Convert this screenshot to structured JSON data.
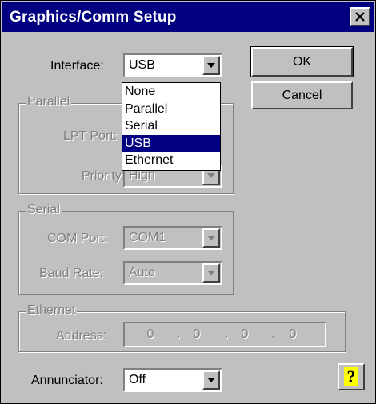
{
  "window": {
    "title": "Graphics/Comm Setup"
  },
  "interface": {
    "label": "Interface:",
    "value": "USB",
    "options": [
      "None",
      "Parallel",
      "Serial",
      "USB",
      "Ethernet"
    ],
    "selected_index": 3
  },
  "buttons": {
    "ok": "OK",
    "cancel": "Cancel"
  },
  "parallel": {
    "legend": "Parallel",
    "lpt_label": "LPT Port:",
    "priority_label": "Priority:",
    "priority_value": "High"
  },
  "serial": {
    "legend": "Serial",
    "com_label": "COM Port:",
    "com_value": "COM1",
    "baud_label": "Baud Rate:",
    "baud_value": "Auto"
  },
  "ethernet": {
    "legend": "Ethernet",
    "address_label": "Address:",
    "octets": [
      "0",
      "0",
      "0",
      "0"
    ],
    "separator": "."
  },
  "annunciator": {
    "label": "Annunciator:",
    "value": "Off"
  },
  "icons": {
    "close": "close-icon",
    "dropdown": "chevron-down-icon",
    "help": "help-icon"
  },
  "colors": {
    "titlebar": "#000080",
    "dialog": "#c0c0c0",
    "selection": "#000080"
  }
}
